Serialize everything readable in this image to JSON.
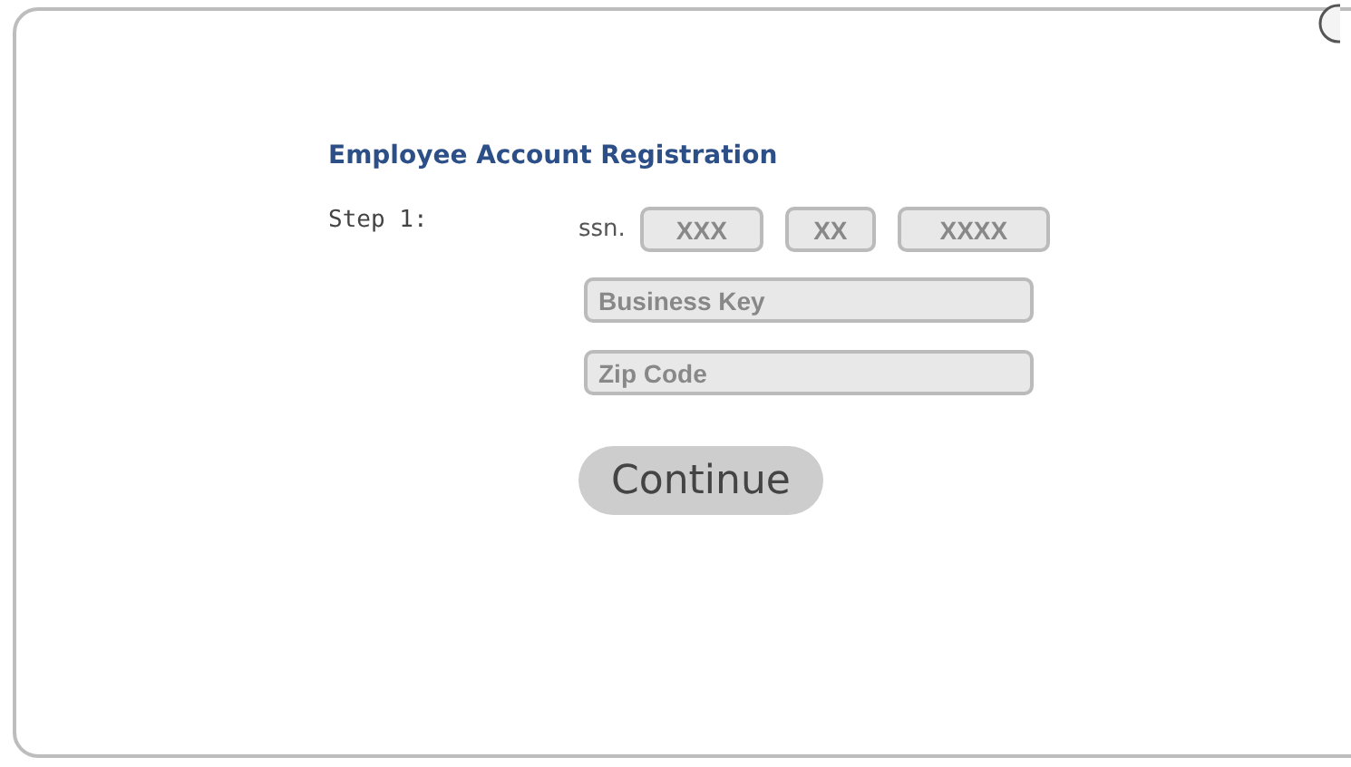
{
  "dialog": {
    "title": "Employee Account Registration",
    "step_label": "Step 1:",
    "ssn": {
      "label": "ssn.",
      "fields": [
        {
          "placeholder": "XXX"
        },
        {
          "placeholder": "XX"
        },
        {
          "placeholder": "XXXX"
        }
      ]
    },
    "fields": [
      {
        "placeholder": "Business Key"
      },
      {
        "placeholder": "Zip Code"
      }
    ],
    "button": "Continue"
  }
}
